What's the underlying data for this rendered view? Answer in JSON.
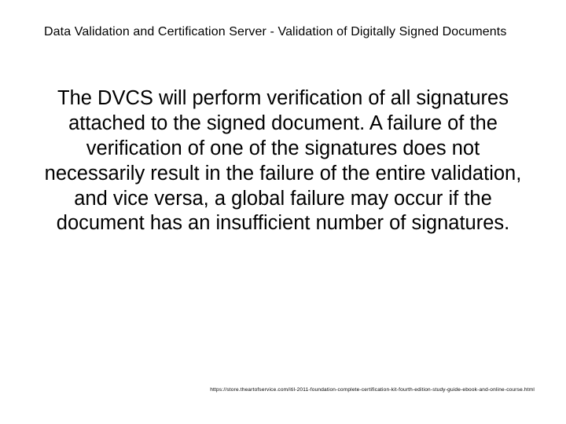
{
  "title": "Data Validation and Certification Server -  Validation of Digitally Signed Documents",
  "body": "The DVCS will perform verification of all signatures attached to the signed document.  A failure of the verification of one of the signatures does not necessarily result in the failure of the entire validation, and vice versa, a global failure may occur if the document has an insufficient number of signatures.",
  "footer": "https://store.theartofservice.com/itil-2011-foundation-complete-certification-kit-fourth-edition-study-guide-ebook-and-online-course.html"
}
